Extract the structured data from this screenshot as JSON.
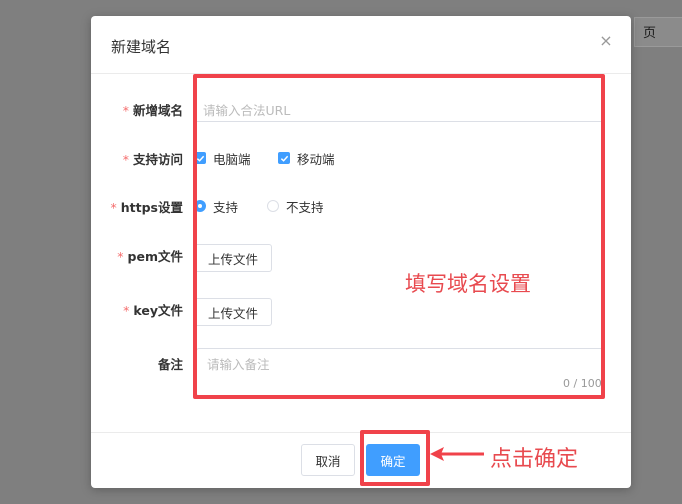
{
  "background": {
    "page_label": "页"
  },
  "modal": {
    "title": "新建域名",
    "close_glyph": "×"
  },
  "form": {
    "domain": {
      "label": "新增域名",
      "placeholder": "请输入合法URL"
    },
    "access": {
      "label": "支持访问",
      "options": [
        "电脑端",
        "移动端"
      ],
      "checked": [
        true,
        true
      ]
    },
    "https": {
      "label": "https设置",
      "options": [
        "支持",
        "不支持"
      ],
      "selected": "支持"
    },
    "pem": {
      "label": "pem文件",
      "button": "上传文件"
    },
    "key": {
      "label": "key文件",
      "button": "上传文件"
    },
    "remark": {
      "label": "备注",
      "placeholder": "请输入备注",
      "counter": "0 / 100"
    },
    "required_mark": "*"
  },
  "footer": {
    "cancel": "取消",
    "confirm": "确定"
  },
  "annotations": {
    "form_note": "填写域名设置",
    "click_note": "点击确定",
    "highlight_color": "#f0424a"
  },
  "colors": {
    "primary": "#409eff",
    "required": "#f56c6c",
    "overlay": "#7f7f7f"
  }
}
